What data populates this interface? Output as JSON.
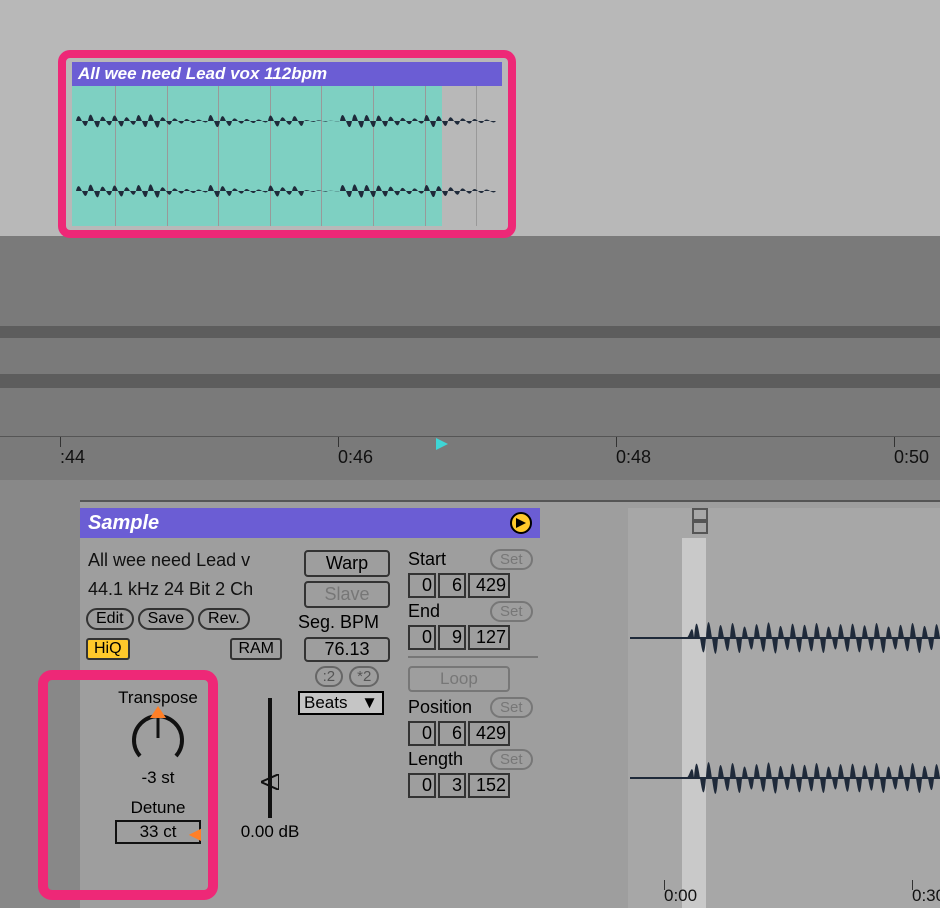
{
  "clip": {
    "title": "All wee need Lead vox 112bpm"
  },
  "ruler": {
    "labels": [
      ":44",
      "0:46",
      "0:48",
      "0:50"
    ]
  },
  "sample_panel": {
    "header": "Sample",
    "sample_name": "All wee need Lead v",
    "sample_format": "44.1 kHz 24 Bit 2 Ch",
    "buttons": {
      "edit": "Edit",
      "save": "Save",
      "rev": "Rev.",
      "hiq": "HiQ",
      "ram": "RAM"
    },
    "warp": {
      "warp": "Warp",
      "slave": "Slave",
      "seg_label": "Seg. BPM",
      "seg_val": "76.13",
      "half": ":2",
      "double": "*2",
      "mode": "Beats"
    },
    "markers": {
      "start_label": "Start",
      "start_bars": "0",
      "start_beats": "6",
      "start_ticks": "429",
      "end_label": "End",
      "end_bars": "0",
      "end_beats": "9",
      "end_ticks": "127",
      "loop": "Loop",
      "pos_label": "Position",
      "pos_bars": "0",
      "pos_beats": "6",
      "pos_ticks": "429",
      "len_label": "Length",
      "len_bars": "0",
      "len_beats": "3",
      "len_ticks": "152",
      "set": "Set"
    },
    "transpose": {
      "label": "Transpose",
      "value": "-3 st",
      "detune_label": "Detune",
      "detune_value": "33 ct"
    },
    "volume": {
      "value": "0.00 dB"
    }
  },
  "sample_ruler": {
    "labels": [
      "0:00",
      "0:30"
    ]
  }
}
